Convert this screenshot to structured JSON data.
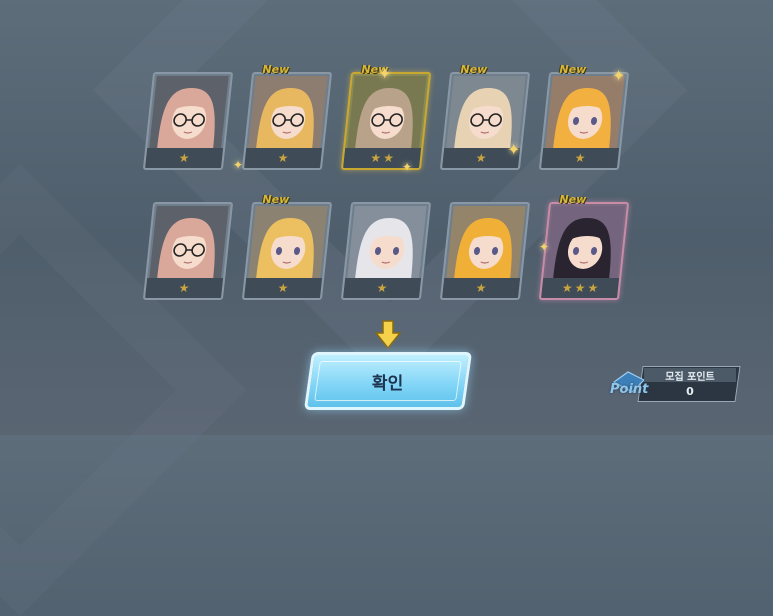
{
  "results": [
    {
      "stars": 1,
      "new": false,
      "hair": "#d9a89a",
      "accent": "#3a2a2a",
      "glasses": true
    },
    {
      "stars": 1,
      "new": true,
      "hair": "#e8b860",
      "accent": "#c77a40",
      "glasses": true
    },
    {
      "stars": 2,
      "new": true,
      "hair": "#b8a28a",
      "accent": "#5a5a4a",
      "glasses": true
    },
    {
      "stars": 1,
      "new": true,
      "hair": "#e8d2b4",
      "accent": "#9a9a9a",
      "glasses": true
    },
    {
      "stars": 1,
      "new": true,
      "hair": "#f2b040",
      "accent": "#e07a2a",
      "glasses": false
    },
    {
      "stars": 1,
      "new": false,
      "hair": "#d9a89a",
      "accent": "#3a2a2a",
      "glasses": true
    },
    {
      "stars": 1,
      "new": true,
      "hair": "#ecc060",
      "accent": "#c48a40",
      "glasses": false
    },
    {
      "stars": 1,
      "new": false,
      "hair": "#e6e6ea",
      "accent": "#b0b0ba",
      "glasses": false
    },
    {
      "stars": 1,
      "new": false,
      "hair": "#f0b038",
      "accent": "#d8902a",
      "glasses": false
    },
    {
      "stars": 3,
      "new": true,
      "hair": "#2a2430",
      "accent": "#6a5a7a",
      "glasses": false
    }
  ],
  "labels": {
    "new": "New",
    "star": "★"
  },
  "confirm_button": {
    "label": "확인"
  },
  "points": {
    "icon_word": "Point",
    "title": "모집 포인트",
    "value": "0"
  },
  "colors": {
    "star": "#c9a540",
    "new_tag": "#d8b63a",
    "button": "#7fd4f6",
    "arrow": "#f5d24a"
  }
}
